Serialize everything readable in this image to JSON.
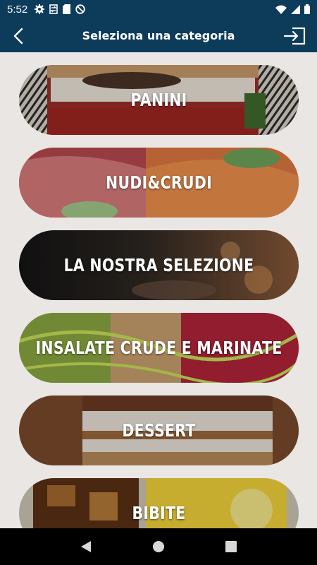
{
  "status_bar": {
    "time": "5:52",
    "icons": [
      "gear-icon",
      "sync-icon",
      "sd-card-icon",
      "do-not-disturb-icon"
    ],
    "right_icons": [
      "wifi-icon",
      "signal-icon",
      "battery-icon"
    ]
  },
  "app_bar": {
    "title": "Seleziona una categoria",
    "back_icon": "chevron-left-icon",
    "logout_icon": "logout-icon",
    "color": "#0d3b5a"
  },
  "categories": [
    {
      "label": "PANINI",
      "image": "burger-photo"
    },
    {
      "label": "NUDI&CRUDI",
      "image": "raw-fish-photo"
    },
    {
      "label": "LA NOSTRA SELEZIONE",
      "image": "restaurant-photo"
    },
    {
      "label": "INSALATE CRUDE E MARINATE",
      "image": "salad-photo"
    },
    {
      "label": "DESSERT",
      "image": "tiramisu-photo"
    },
    {
      "label": "BIBITE",
      "image": "drinks-photo"
    }
  ],
  "nav_bar": {
    "back_icon": "triangle-back-icon",
    "home_icon": "circle-home-icon",
    "recents_icon": "square-recents-icon"
  }
}
